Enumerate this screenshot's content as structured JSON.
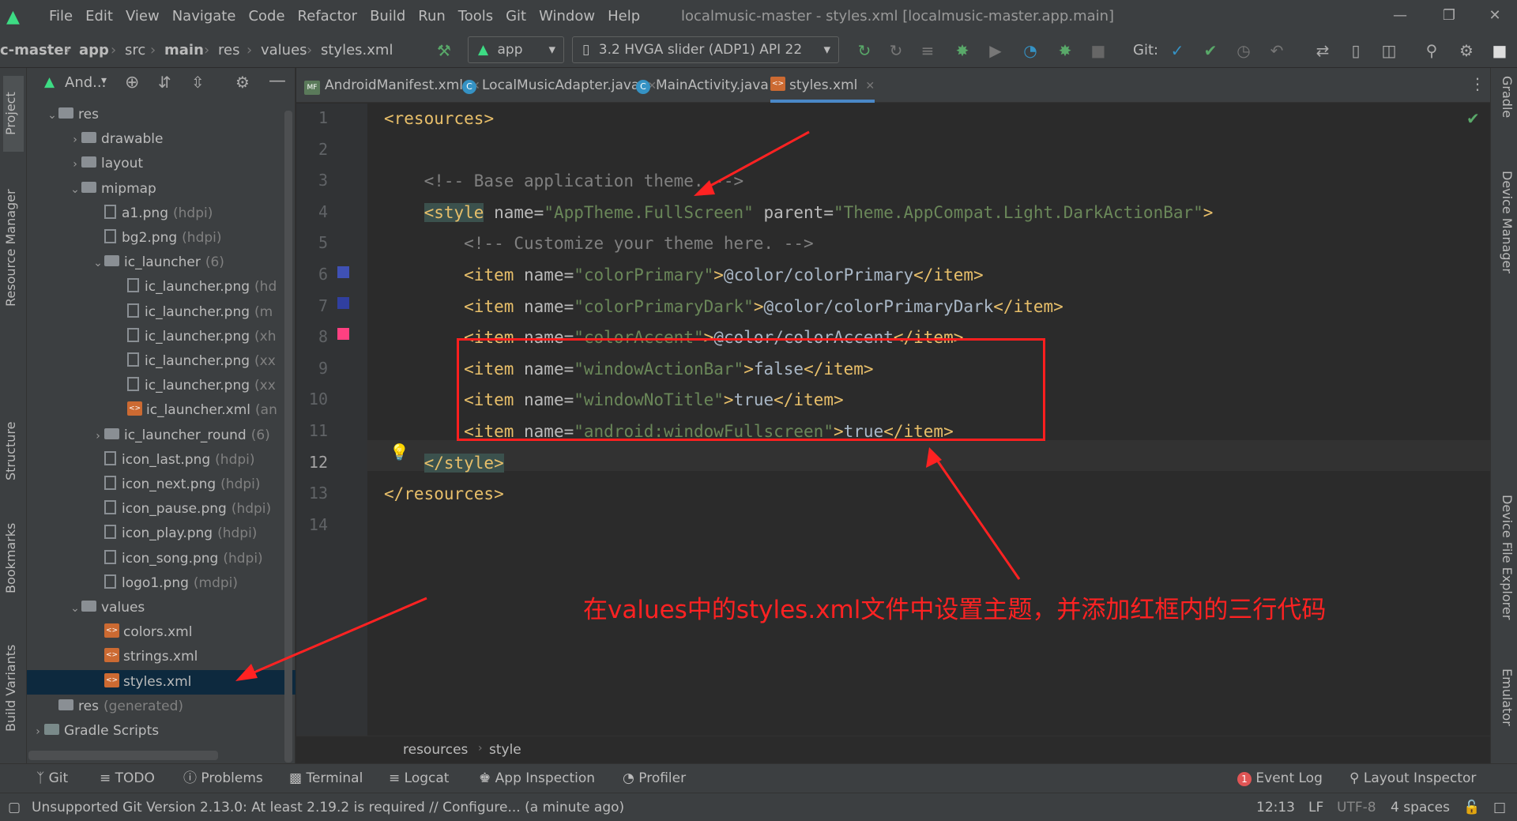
{
  "menu": [
    "File",
    "Edit",
    "View",
    "Navigate",
    "Code",
    "Refactor",
    "Build",
    "Run",
    "Tools",
    "Git",
    "Window",
    "Help"
  ],
  "window_title": "localmusic-master - styles.xml [localmusic-master.app.main]",
  "breadcrumbs": [
    "c-master",
    "app",
    "src",
    "main",
    "res",
    "values",
    "styles.xml"
  ],
  "run_config": "app",
  "device": "3.2  HVGA slider (ADP1) API 22",
  "git_label": "Git:",
  "project_view_label": "And...",
  "left_tabs": [
    "Project",
    "Resource Manager",
    "Structure",
    "Bookmarks",
    "Build Variants"
  ],
  "right_tabs": [
    "Gradle",
    "Device Manager",
    "Device File Explorer",
    "Emulator"
  ],
  "tree": [
    {
      "label": "res",
      "hint": "",
      "kind": "folder",
      "indent": 0,
      "arrow": "open"
    },
    {
      "label": "drawable",
      "hint": "",
      "kind": "folder",
      "indent": 1,
      "arrow": "closed"
    },
    {
      "label": "layout",
      "hint": "",
      "kind": "folder",
      "indent": 1,
      "arrow": "closed"
    },
    {
      "label": "mipmap",
      "hint": "",
      "kind": "folder",
      "indent": 1,
      "arrow": "open"
    },
    {
      "label": "a1.png",
      "hint": "(hdpi)",
      "kind": "file",
      "indent": 2,
      "arrow": ""
    },
    {
      "label": "bg2.png",
      "hint": "(hdpi)",
      "kind": "file",
      "indent": 2,
      "arrow": ""
    },
    {
      "label": "ic_launcher",
      "hint": "(6)",
      "kind": "folder",
      "indent": 2,
      "arrow": "open"
    },
    {
      "label": "ic_launcher.png",
      "hint": "(hd",
      "kind": "file",
      "indent": 3,
      "arrow": ""
    },
    {
      "label": "ic_launcher.png",
      "hint": "(m",
      "kind": "file",
      "indent": 3,
      "arrow": ""
    },
    {
      "label": "ic_launcher.png",
      "hint": "(xh",
      "kind": "file",
      "indent": 3,
      "arrow": ""
    },
    {
      "label": "ic_launcher.png",
      "hint": "(xx",
      "kind": "file",
      "indent": 3,
      "arrow": ""
    },
    {
      "label": "ic_launcher.png",
      "hint": "(xx",
      "kind": "file",
      "indent": 3,
      "arrow": ""
    },
    {
      "label": "ic_launcher.xml",
      "hint": "(an",
      "kind": "xml",
      "indent": 3,
      "arrow": ""
    },
    {
      "label": "ic_launcher_round",
      "hint": "(6)",
      "kind": "folder",
      "indent": 2,
      "arrow": "closed"
    },
    {
      "label": "icon_last.png",
      "hint": "(hdpi)",
      "kind": "file",
      "indent": 2,
      "arrow": ""
    },
    {
      "label": "icon_next.png",
      "hint": "(hdpi)",
      "kind": "file",
      "indent": 2,
      "arrow": ""
    },
    {
      "label": "icon_pause.png",
      "hint": "(hdpi)",
      "kind": "file",
      "indent": 2,
      "arrow": ""
    },
    {
      "label": "icon_play.png",
      "hint": "(hdpi)",
      "kind": "file",
      "indent": 2,
      "arrow": ""
    },
    {
      "label": "icon_song.png",
      "hint": "(hdpi)",
      "kind": "file",
      "indent": 2,
      "arrow": ""
    },
    {
      "label": "logo1.png",
      "hint": "(mdpi)",
      "kind": "file",
      "indent": 2,
      "arrow": ""
    },
    {
      "label": "values",
      "hint": "",
      "kind": "folder",
      "indent": 1,
      "arrow": "open"
    },
    {
      "label": "colors.xml",
      "hint": "",
      "kind": "xml",
      "indent": 2,
      "arrow": ""
    },
    {
      "label": "strings.xml",
      "hint": "",
      "kind": "xml",
      "indent": 2,
      "arrow": ""
    },
    {
      "label": "styles.xml",
      "hint": "",
      "kind": "xml",
      "indent": 2,
      "arrow": "",
      "selected": true
    },
    {
      "label": "res",
      "hint": "(generated)",
      "kind": "folder",
      "indent": 0,
      "arrow": ""
    },
    {
      "label": "Gradle Scripts",
      "hint": "",
      "kind": "gradle",
      "indent": -1,
      "arrow": "closed"
    }
  ],
  "tabs": [
    {
      "label": "AndroidManifest.xml",
      "icon": "MF",
      "active": false
    },
    {
      "label": "LocalMusicAdapter.java",
      "icon": "C",
      "active": false
    },
    {
      "label": "MainActivity.java",
      "icon": "C",
      "active": false
    },
    {
      "label": "styles.xml",
      "icon": "xml",
      "active": true
    }
  ],
  "code_lines": [
    "<resources>",
    "",
    "    <!-- Base application theme. -->",
    "    <style name=\"AppTheme.FullScreen\" parent=\"Theme.AppCompat.Light.DarkActionBar\">",
    "        <!-- Customize your theme here. -->",
    "        <item name=\"colorPrimary\">@color/colorPrimary</item>",
    "        <item name=\"colorPrimaryDark\">@color/colorPrimaryDark</item>",
    "        <item name=\"colorAccent\">@color/colorAccent</item>",
    "        <item name=\"windowActionBar\">false</item>",
    "        <item name=\"windowNoTitle\">true</item>",
    "        <item name=\"android:windowFullscreen\">true</item>",
    "    </style>",
    "</resources>",
    ""
  ],
  "line_numbers": [
    "1",
    "2",
    "3",
    "4",
    "5",
    "6",
    "7",
    "8",
    "9",
    "10",
    "11",
    "12",
    "13",
    "14"
  ],
  "current_line": 12,
  "swatch_colors": {
    "line6": "#3f51b5",
    "line7": "#303f9f",
    "line8": "#ff4081"
  },
  "annotation": "在values中的styles.xml文件中设置主题，并添加红框内的三行代码",
  "editor_breadcrumb": [
    "resources",
    "style"
  ],
  "bottom_tools": [
    "Git",
    "TODO",
    "Problems",
    "Terminal",
    "Logcat",
    "App Inspection",
    "Profiler"
  ],
  "bottom_right_tools": {
    "event_log": "Event Log",
    "event_count": "1",
    "layout_inspector": "Layout Inspector"
  },
  "status": {
    "message": "Unsupported Git Version 2.13.0: At least 2.19.2 is required // Configure... (a minute ago)",
    "position": "12:13",
    "line_sep": "LF",
    "encoding": "UTF-8",
    "indent": "4 spaces"
  },
  "colors": {
    "accent": "#4a88c7",
    "annotation_red": "#ff2222",
    "bg": "#2b2b2b"
  }
}
